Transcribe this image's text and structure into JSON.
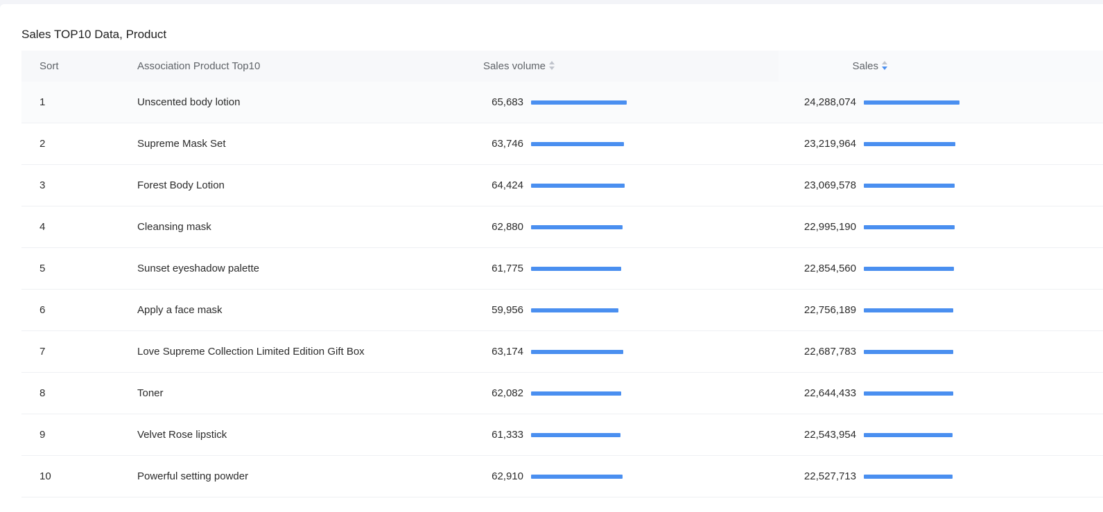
{
  "title": "Sales TOP10 Data, Product",
  "headers": {
    "sort": "Sort",
    "product": "Association Product Top10",
    "volume": "Sales volume",
    "sales": "Sales"
  },
  "sort_state": {
    "volume": "none",
    "sales": "descending"
  },
  "colors": {
    "bar": "#4a8ff0",
    "sorter_active": "#4a8ff0",
    "sorter_inactive": "#c0c4cc"
  },
  "rows": [
    {
      "rank": "1",
      "product": "Unscented body lotion",
      "volume": "65,683",
      "volume_value": 65683,
      "sales": "24,288,074",
      "sales_value": 24288074
    },
    {
      "rank": "2",
      "product": "Supreme Mask Set",
      "volume": "63,746",
      "volume_value": 63746,
      "sales": "23,219,964",
      "sales_value": 23219964
    },
    {
      "rank": "3",
      "product": "Forest Body Lotion",
      "volume": "64,424",
      "volume_value": 64424,
      "sales": "23,069,578",
      "sales_value": 23069578
    },
    {
      "rank": "4",
      "product": "Cleansing mask",
      "volume": "62,880",
      "volume_value": 62880,
      "sales": "22,995,190",
      "sales_value": 22995190
    },
    {
      "rank": "5",
      "product": "Sunset eyeshadow palette",
      "volume": "61,775",
      "volume_value": 61775,
      "sales": "22,854,560",
      "sales_value": 22854560
    },
    {
      "rank": "6",
      "product": "Apply a face mask",
      "volume": "59,956",
      "volume_value": 59956,
      "sales": "22,756,189",
      "sales_value": 22756189
    },
    {
      "rank": "7",
      "product": "Love Supreme Collection Limited Edition Gift Box",
      "volume": "63,174",
      "volume_value": 63174,
      "sales": "22,687,783",
      "sales_value": 22687783
    },
    {
      "rank": "8",
      "product": "Toner",
      "volume": "62,082",
      "volume_value": 62082,
      "sales": "22,644,433",
      "sales_value": 22644433
    },
    {
      "rank": "9",
      "product": "Velvet Rose lipstick",
      "volume": "61,333",
      "volume_value": 61333,
      "sales": "22,543,954",
      "sales_value": 22543954
    },
    {
      "rank": "10",
      "product": "Powerful setting powder",
      "volume": "62,910",
      "volume_value": 62910,
      "sales": "22,527,713",
      "sales_value": 22527713
    }
  ]
}
